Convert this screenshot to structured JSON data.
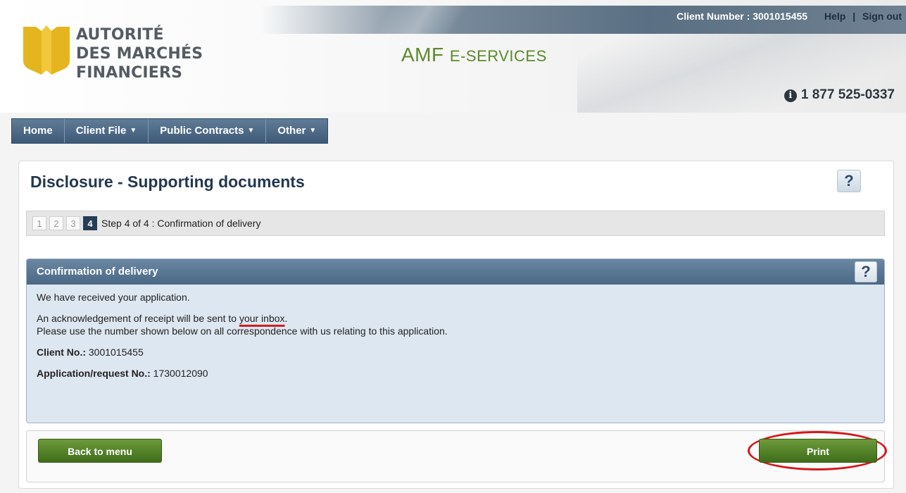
{
  "header": {
    "org_name_line1": "AUTORITÉ",
    "org_name_line2": "DES MARCHÉS",
    "org_name_line3": "FINANCIERS",
    "app_title_main": "AMF ",
    "app_title_sc": "E-SERVICES",
    "client_number_label": "Client Number : 3001015455",
    "help_link": "Help",
    "separator": "|",
    "signout_link": "Sign out",
    "phone": "1 877 525-0337",
    "info_icon": "i"
  },
  "nav": {
    "items": [
      {
        "label": "Home",
        "has_menu": false
      },
      {
        "label": "Client File",
        "has_menu": true
      },
      {
        "label": "Public Contracts",
        "has_menu": true
      },
      {
        "label": "Other",
        "has_menu": true
      }
    ],
    "caret": "▼"
  },
  "page": {
    "title": "Disclosure - Supporting documents",
    "help": "?",
    "steps": [
      "1",
      "2",
      "3",
      "4"
    ],
    "step_label": "Step 4 of 4 : Confirmation of delivery"
  },
  "confirmation": {
    "header": "Confirmation of delivery",
    "help": "?",
    "received": "We have received your application.",
    "ack_prefix": "An acknowledgement of receipt will be sent to ",
    "ack_link": "your inbox",
    "ack_suffix": ".",
    "use_number": "Please use the number shown below on all correspondence with us relating to this application.",
    "client_no_label": "Client No.:",
    "client_no_value": " 3001015455",
    "app_no_label": "Application/request No.:",
    "app_no_value": " 1730012090"
  },
  "actions": {
    "back_label": "Back to menu",
    "print_label": "Print"
  },
  "colors": {
    "accent_green": "#5a8a2a",
    "logo_gold": "#e4b51e",
    "nav_blue": "#4a6885",
    "highlight_red": "#d6181c"
  }
}
